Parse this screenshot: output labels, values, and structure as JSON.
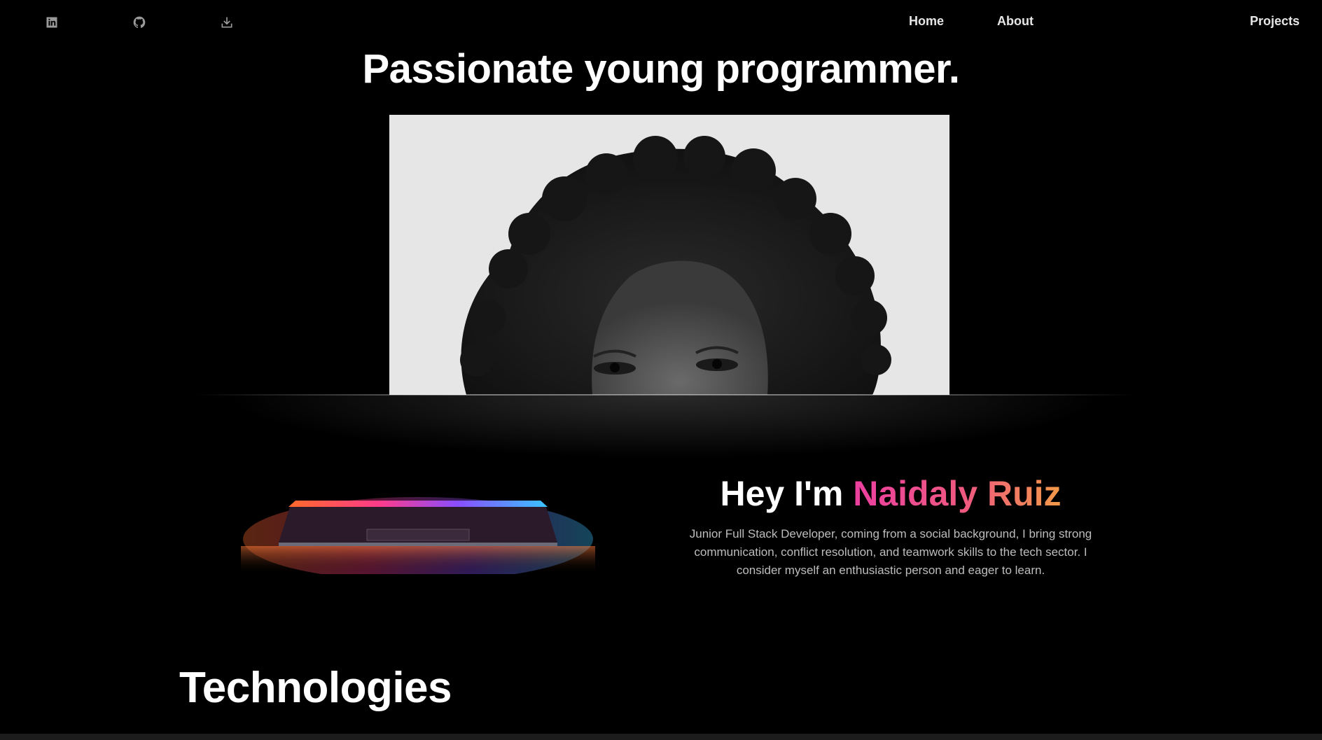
{
  "social": {
    "items": [
      {
        "icon": "linkedin-icon",
        "label": "LinkedIn"
      },
      {
        "icon": "github-icon",
        "label": "GitHub"
      },
      {
        "icon": "download-icon",
        "label": "Download CV"
      }
    ]
  },
  "nav": {
    "items": [
      {
        "label": "Home"
      },
      {
        "label": "About"
      },
      {
        "label": "Projects"
      }
    ]
  },
  "hero": {
    "title": "Passionate young programmer."
  },
  "intro": {
    "greeting": "Hey I'm",
    "name": "Naidaly Ruiz",
    "description": "Junior Full Stack Developer, coming from a social background, I bring strong communication, conflict resolution, and teamwork skills to the tech sector. I consider myself an enthusiastic person and eager to learn."
  },
  "sections": {
    "technologies_title": "Technologies"
  },
  "colors": {
    "background": "#000000",
    "text": "#ffffff",
    "muted_text": "#bdbdbd",
    "gradient_start": "#ec3fa0",
    "gradient_end": "#f39a48"
  }
}
